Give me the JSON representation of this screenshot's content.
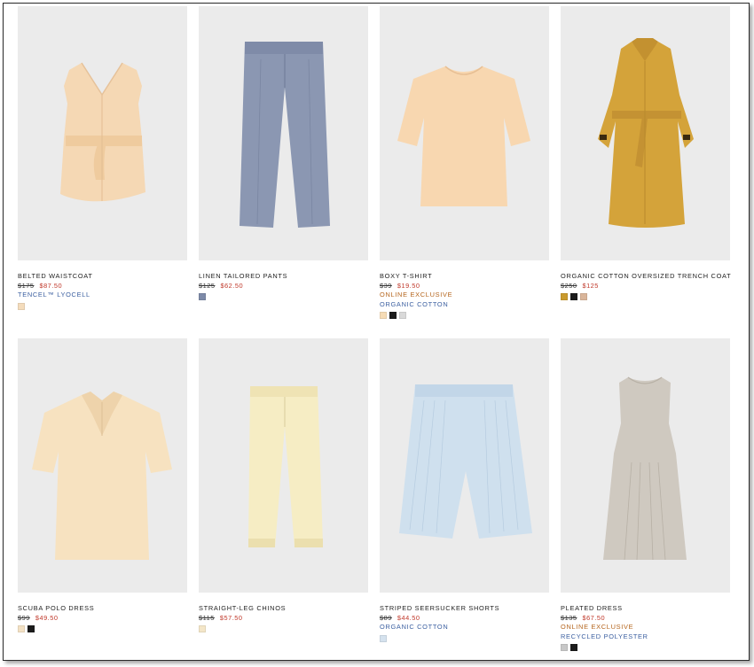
{
  "colors": {
    "sale_price": "#c0392b",
    "exclusive_tag": "#b5651d",
    "material_tag": "#3b5fa0",
    "photo_background": "#ebebeb"
  },
  "products": [
    {
      "name": "BELTED WAISTCOAT",
      "old_price": "$175",
      "new_price": "$87.50",
      "tags": [
        {
          "text": "TENCEL™ LYOCELL",
          "kind": "material"
        }
      ],
      "swatches": [
        "#f4dcbc"
      ],
      "image": "waistcoat-image"
    },
    {
      "name": "LINEN TAILORED PANTS",
      "old_price": "$125",
      "new_price": "$62.50",
      "tags": [],
      "swatches": [
        "#7d8aa8"
      ],
      "image": "pants-image"
    },
    {
      "name": "BOXY T-SHIRT",
      "old_price": "$39",
      "new_price": "$19.50",
      "tags": [
        {
          "text": "ONLINE EXCLUSIVE",
          "kind": "exclusive"
        },
        {
          "text": "ORGANIC COTTON",
          "kind": "material"
        }
      ],
      "swatches": [
        "#f6dcb6",
        "#1c1c1c",
        "#d9d9d9"
      ],
      "image": "tshirt-image"
    },
    {
      "name": "ORGANIC COTTON OVERSIZED TRENCH COAT",
      "old_price": "$250",
      "new_price": "$125",
      "tags": [],
      "swatches": [
        "#c99a2e",
        "#1c1c1c",
        "#d9b59a"
      ],
      "image": "trench-coat-image"
    },
    {
      "name": "SCUBA POLO DRESS",
      "old_price": "$99",
      "new_price": "$49.50",
      "tags": [],
      "swatches": [
        "#f3e1c4",
        "#1c1c1c"
      ],
      "image": "polo-dress-image"
    },
    {
      "name": "STRAIGHT-LEG CHINOS",
      "old_price": "$115",
      "new_price": "$57.50",
      "tags": [],
      "swatches": [
        "#f4e6c8"
      ],
      "image": "chinos-image"
    },
    {
      "name": "STRIPED SEERSUCKER SHORTS",
      "old_price": "$89",
      "new_price": "$44.50",
      "tags": [
        {
          "text": "ORGANIC COTTON",
          "kind": "material"
        }
      ],
      "swatches": [
        "#d5e2ee"
      ],
      "image": "shorts-image"
    },
    {
      "name": "PLEATED DRESS",
      "old_price": "$135",
      "new_price": "$67.50",
      "tags": [
        {
          "text": "ONLINE EXCLUSIVE",
          "kind": "exclusive"
        },
        {
          "text": "RECYCLED POLYESTER",
          "kind": "material"
        }
      ],
      "swatches": [
        "#c8c8c8",
        "#1c1c1c"
      ],
      "image": "pleated-dress-image"
    }
  ]
}
